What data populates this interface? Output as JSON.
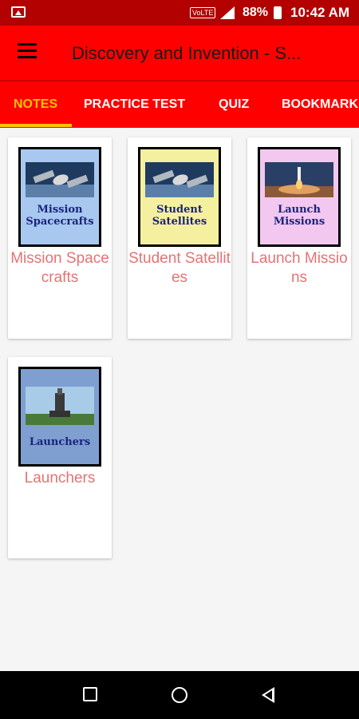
{
  "status_bar": {
    "volte": "VoLTE",
    "battery_pct": "88%",
    "time": "10:42 AM"
  },
  "app_bar": {
    "title": "Discovery and Invention - S..."
  },
  "tabs": [
    {
      "label": "NOTES",
      "active": true
    },
    {
      "label": "PRACTICE TEST",
      "active": false
    },
    {
      "label": "QUIZ",
      "active": false
    },
    {
      "label": "BOOKMARK",
      "active": false
    }
  ],
  "cards": [
    {
      "thumb_caption": "Mission Spacecrafts",
      "label": "Mission Spacecrafts",
      "thumb_bg": "#a8c8f0",
      "icon": "spacecraft-image"
    },
    {
      "thumb_caption": "Student Satellites",
      "label": "Student Satellites",
      "thumb_bg": "#f5f0a0",
      "icon": "satellite-image"
    },
    {
      "thumb_caption": "Launch Missions",
      "label": "Launch Missions",
      "thumb_bg": "#f2c8f0",
      "icon": "rocket-launch-image"
    },
    {
      "thumb_caption": "Launchers",
      "label": "Launchers",
      "thumb_bg": "#7f9fd0",
      "icon": "launchpad-image"
    }
  ],
  "colors": {
    "accent": "#ff0000",
    "tab_active": "#ffc107",
    "card_label": "#e57373"
  }
}
